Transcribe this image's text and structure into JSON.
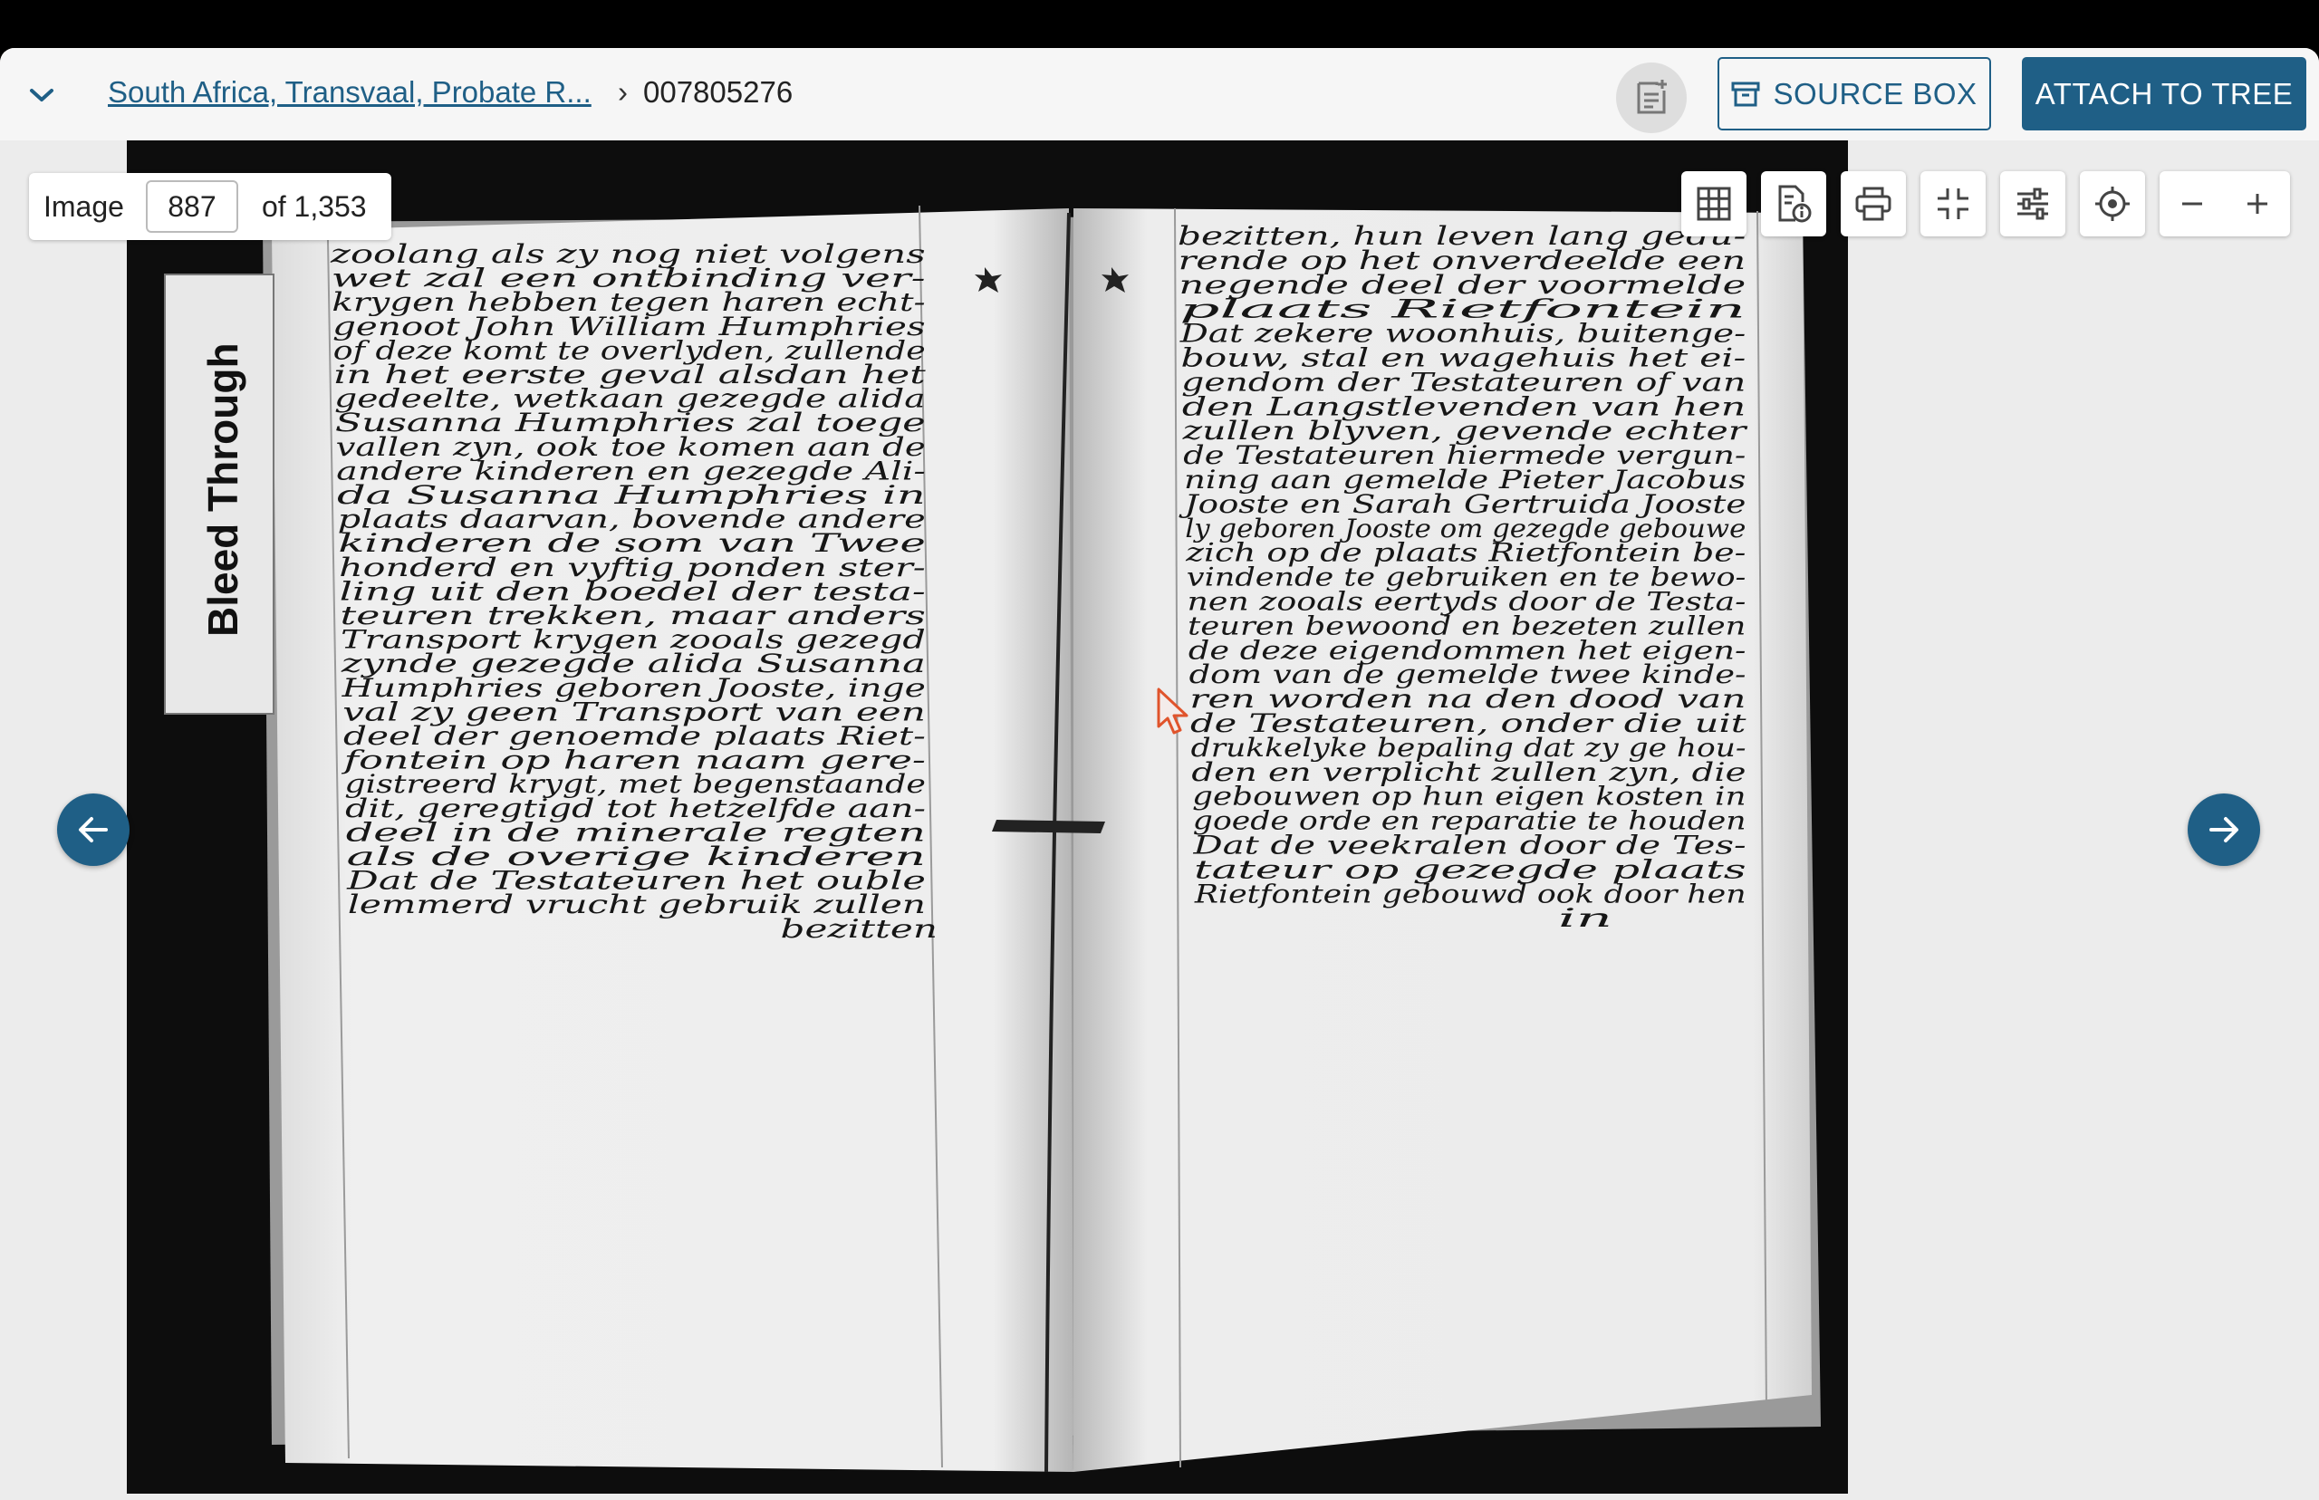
{
  "header": {
    "breadcrumb_link": "South Africa, Transvaal, Probate R...",
    "breadcrumb_separator": "›",
    "breadcrumb_current": "007805276",
    "source_box_label": "SOURCE BOX",
    "attach_label": "ATTACH TO TREE"
  },
  "viewer": {
    "image_label": "Image",
    "current_page": "887",
    "total_label": "of 1,353",
    "tab_label": "Bleed Through",
    "left_page_lines": [
      "zoolang als zy nog niet volgens",
      "wet zal een ontbinding ver-",
      "krygen hebben tegen haren echt-",
      "genoot John William Humphries",
      "of deze komt te overlyden, zullende",
      "in het eerste geval alsdan het",
      "gedeelte, wetkaan gezegde alida",
      "Susanna Humphries zal toege",
      "vallen zyn, ook toe komen aan de",
      "andere kinderen en gezegde Ali-",
      "da Susanna Humphries in",
      "plaats daarvan, bovende andere",
      "kinderen de som van Twee",
      "honderd en vyftig ponden ster-",
      "ling uit den boedel der testa-",
      "teuren trekken, maar anders",
      "Transport krygen zooals gezegd",
      "zynde gezegde alida Susanna",
      "Humphries geboren Jooste, inge",
      "val zy geen Transport van een",
      "deel der genoemde plaats Riet-",
      "fontein op haren naam gere-",
      "gistreerd krygt, met begenstaande",
      "dit, geregtigd tot hetzelfde aan-",
      "deel in de minerale regten",
      "als de overige kinderen",
      "Dat de Testateuren het ouble",
      "lemmerd vrucht gebruik zullen",
      "bezitten"
    ],
    "right_page_lines": [
      "bezitten, hun leven lang gedu-",
      "rende op het onverdeelde een",
      "negende deel der voormelde",
      "plaats Rietfontein",
      "Dat zekere woonhuis, buitenge-",
      "bouw, stal en wagehuis het ei-",
      "gendom der Testateuren of van",
      "den Langstlevenden van hen",
      "zullen blyven, gevende echter",
      "de Testateuren hiermede vergun-",
      "ning aan gemelde Pieter Jacobus",
      "Jooste en Sarah Gertruida Jooste",
      "ly geboren Jooste om gezegde gebouwe",
      "zich op de plaats Rietfontein be-",
      "vindende te gebruiken en te bewo-",
      "nen zooals eertyds door de Testa-",
      "teuren bewoond en bezeten zullen",
      "de deze eigendommen het eigen-",
      "dom van de gemelde twee kinde-",
      "ren worden na den dood van",
      "de Testateuren, onder die uit",
      "drukkelyke bepaling dat zy ge hou-",
      "den en verplicht zullen zyn, die",
      "gebouwen op hun eigen kosten in",
      "goede orde en reparatie te houden",
      "Dat de veekralen door de Tes-",
      "tateur op gezegde plaats",
      "Rietfontein gebouwd ook door hen",
      "in"
    ]
  },
  "icons": {
    "collapse": "chevron-down-icon",
    "notes": "notes-icon",
    "source_box": "archive-box-icon",
    "grid": "grid-icon",
    "info": "document-info-icon",
    "print": "print-icon",
    "exit_fullscreen": "exit-fullscreen-icon",
    "adjust": "sliders-icon",
    "locate": "crosshair-icon",
    "zoom_out": "minus-icon",
    "zoom_in": "plus-icon",
    "prev": "arrow-left-icon",
    "next": "arrow-right-icon"
  },
  "colors": {
    "brand": "#1f5f86",
    "header_bg": "#f6f6f6",
    "viewer_bg": "#ececec"
  }
}
